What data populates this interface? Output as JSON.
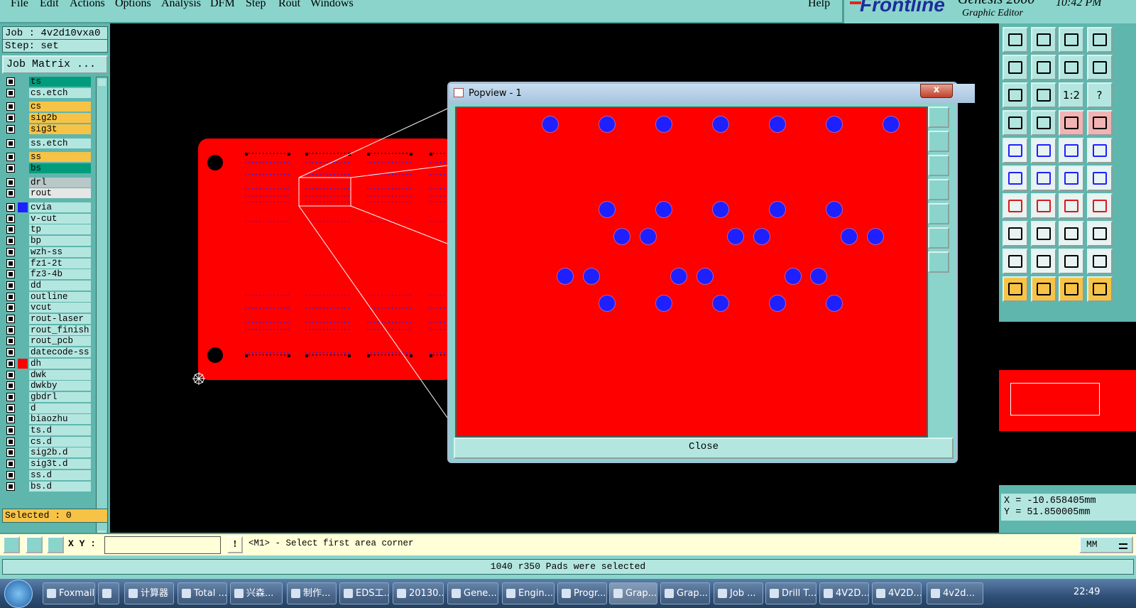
{
  "menu": [
    "File",
    "Edit",
    "Actions",
    "Options",
    "Analysis",
    "DFM",
    "Step",
    "Rout",
    "Windows"
  ],
  "help": "Help",
  "brand": {
    "logo": "Frontline",
    "product": "Genesis 2000",
    "subtitle": "Graphic Editor",
    "clock": "10:42 PM"
  },
  "left": {
    "job": "Job : 4v2d10vxa0",
    "step": "Step: set",
    "job_matrix": "Job Matrix ...",
    "selected": "Selected : 0"
  },
  "layers": [
    {
      "name": "ts",
      "color": "#009c7c"
    },
    {
      "name": "cs.etch",
      "color": "#b4e6e0"
    },
    {
      "name": "cs",
      "color": "#f7c346"
    },
    {
      "name": "sig2b",
      "color": "#f7c346"
    },
    {
      "name": "sig3t",
      "color": "#f7c346"
    },
    {
      "name": "ss.etch",
      "color": "#b4e6e0"
    },
    {
      "name": "ss",
      "color": "#f7c346"
    },
    {
      "name": "bs",
      "color": "#009c7c"
    },
    {
      "name": "drl",
      "color": "#b8c8c8"
    },
    {
      "name": "rout",
      "color": "#e6e6e6"
    },
    {
      "name": "cvia",
      "color": "#b4e6e0",
      "swatch": "#1f20ff"
    },
    {
      "name": "v-cut",
      "color": "#b4e6e0"
    },
    {
      "name": "tp",
      "color": "#b4e6e0"
    },
    {
      "name": "bp",
      "color": "#b4e6e0"
    },
    {
      "name": "wzh-ss",
      "color": "#b4e6e0"
    },
    {
      "name": "fz1-2t",
      "color": "#b4e6e0"
    },
    {
      "name": "fz3-4b",
      "color": "#b4e6e0"
    },
    {
      "name": "dd",
      "color": "#b4e6e0"
    },
    {
      "name": "outline",
      "color": "#b4e6e0"
    },
    {
      "name": "vcut",
      "color": "#b4e6e0"
    },
    {
      "name": "rout-laser",
      "color": "#b4e6e0"
    },
    {
      "name": "rout_finish",
      "color": "#b4e6e0"
    },
    {
      "name": "rout_pcb",
      "color": "#b4e6e0"
    },
    {
      "name": "datecode-ss",
      "color": "#b4e6e0"
    },
    {
      "name": "dh",
      "color": "#b4e6e0",
      "swatch": "#ff0000"
    },
    {
      "name": "dwk",
      "color": "#b4e6e0"
    },
    {
      "name": "dwkby",
      "color": "#b4e6e0"
    },
    {
      "name": "gbdrl",
      "color": "#b4e6e0"
    },
    {
      "name": "d",
      "color": "#b4e6e0"
    },
    {
      "name": "biaozhu",
      "color": "#b4e6e0"
    },
    {
      "name": "ts.d",
      "color": "#b4e6e0"
    },
    {
      "name": "cs.d",
      "color": "#b4e6e0"
    },
    {
      "name": "sig2b.d",
      "color": "#b4e6e0"
    },
    {
      "name": "sig3t.d",
      "color": "#b4e6e0"
    },
    {
      "name": "ss.d",
      "color": "#b4e6e0"
    },
    {
      "name": "bs.d",
      "color": "#b4e6e0"
    }
  ],
  "popview": {
    "title": "Popview - 1",
    "close_x": "x",
    "close_button": "Close"
  },
  "toolbar_labels": {
    "scale_1_2": "1:2",
    "help_q": "?"
  },
  "coords": {
    "x": "X = -10.658405mm",
    "y": "Y = 51.850005mm"
  },
  "command": {
    "xy_label": "X Y :",
    "xy_value": "",
    "bang": "!",
    "prompt": "<M1> - Select first area corner",
    "units": "MM"
  },
  "status": "1040 r350 Pads were selected",
  "taskbar": {
    "tasks": [
      "Foxmail",
      "",
      "计算器",
      "Total ...",
      "兴森...",
      "制作...",
      "EDS工...",
      "20130...",
      "Gene...",
      "Engin...",
      "Progr...",
      "Grap...",
      "Grap...",
      "Job ...",
      "Drill T...",
      "4V2D...",
      "4V2D...",
      "4v2d..."
    ],
    "time": "22:49"
  },
  "colors": {
    "panel": "#5fb6ad",
    "light": "#b4e6e0",
    "board": "#ff0000",
    "pad": "#1f20ff",
    "accent": "#f7c346"
  },
  "pads": [
    {
      "col": 1,
      "row": 0
    },
    {
      "col": 3,
      "row": 0
    },
    {
      "col": 5,
      "row": 0
    },
    {
      "col": 7,
      "row": 0
    },
    {
      "col": 9,
      "row": 0
    },
    {
      "col": 11,
      "row": 0
    },
    {
      "col": 13,
      "row": 0
    }
  ]
}
